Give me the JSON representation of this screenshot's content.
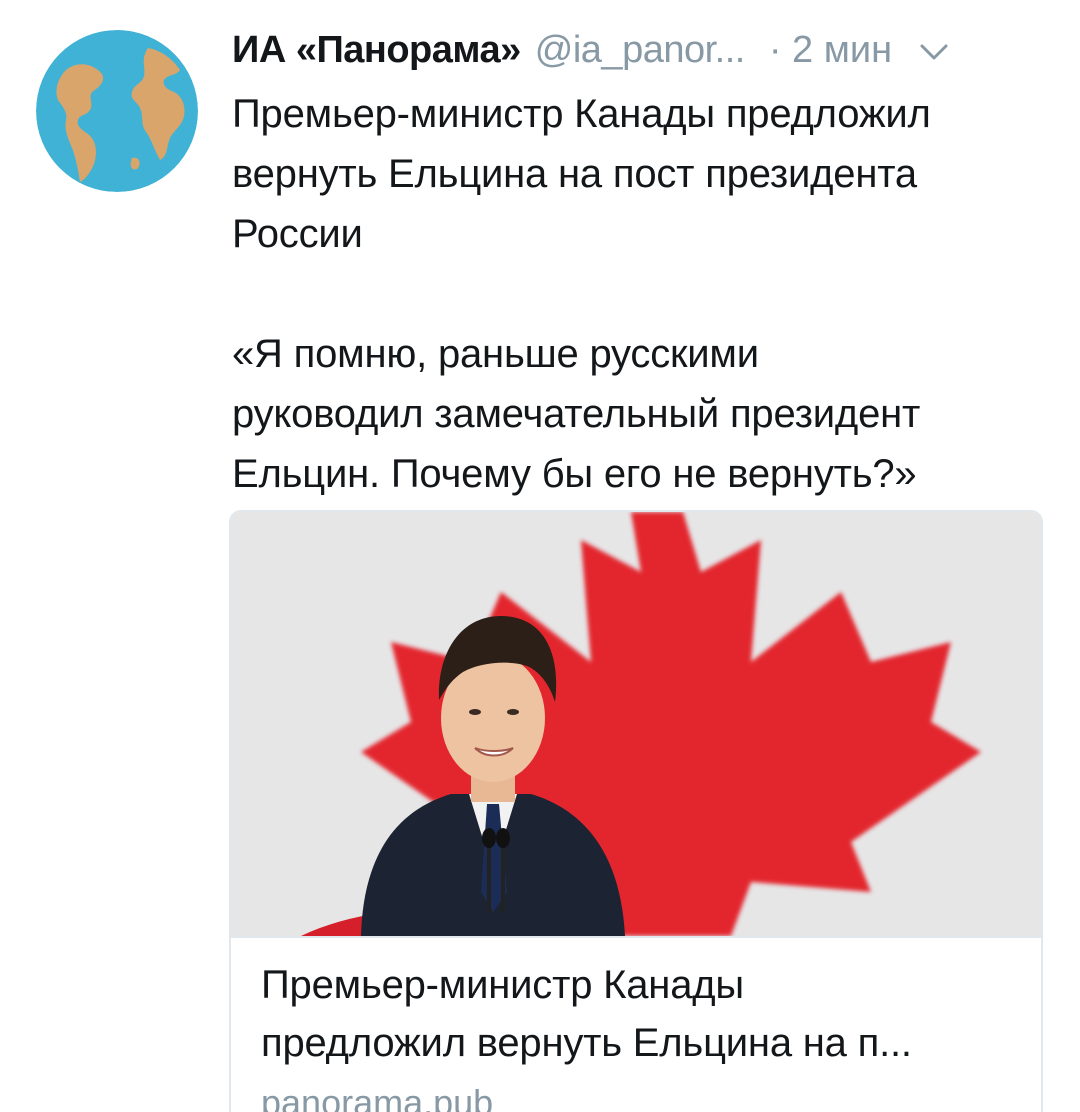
{
  "tweet": {
    "author_name": "ИА «Панорама»",
    "author_handle": "@ia_panor...",
    "timestamp": "· 2 мин",
    "text": "Премьер-министр Канады предложил\nвернуть Ельцина на пост президента\nРоссии\n\n«Я помню, раньше русскими\nруководил замечательный президент\nЕльцин. Почему бы его не вернуть?»"
  },
  "card": {
    "title": "Премьер-министр Канады\nпредложил вернуть Ельцина на п...",
    "domain": "panorama.pub"
  },
  "icons": {
    "avatar": "globe-icon",
    "menu": "chevron-down-icon"
  },
  "colors": {
    "secondary_text": "#8899a6",
    "card_border": "#e1e8ed",
    "globe_ocean": "#3fb2d6",
    "globe_land": "#d9a56a",
    "flag_red": "#e3262d"
  }
}
